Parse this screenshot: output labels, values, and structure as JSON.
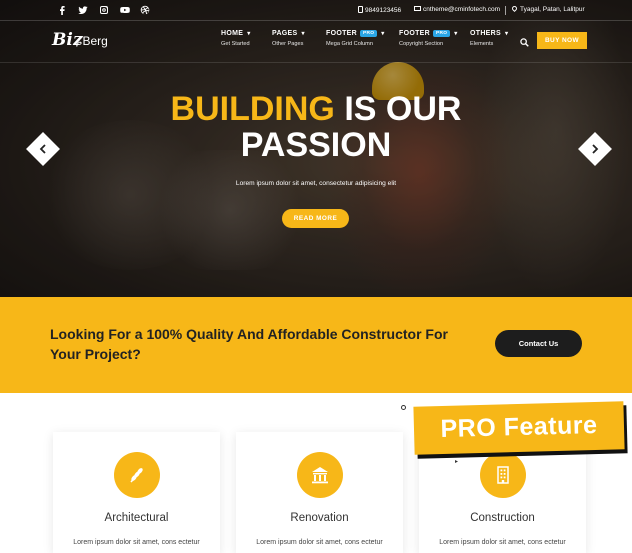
{
  "topbar": {
    "social": [
      "facebook-icon",
      "twitter-icon",
      "instagram-icon",
      "youtube-icon",
      "dribbble-icon"
    ],
    "phone": "9849123456",
    "email": "cntheme@cminfotech.com",
    "address": "Tyagal, Patan, Lalitpur"
  },
  "logo": {
    "part1": "Biʑ",
    "part2": "Berg"
  },
  "nav": {
    "items": [
      {
        "label": "HOME",
        "sub": "Get Started"
      },
      {
        "label": "PAGES",
        "sub": "Other Pages"
      },
      {
        "label": "FOOTER",
        "badge": "PRO",
        "sub": "Mega Grid Column"
      },
      {
        "label": "FOOTER",
        "badge": "PRO",
        "sub": "Copyright Section"
      },
      {
        "label": "OTHERS",
        "sub": "Elements"
      }
    ],
    "buy_label": "BUY NOW"
  },
  "hero": {
    "highlight": "BUILDING",
    "title_rest": " IS OUR",
    "title_line2": "PASSION",
    "subtitle": "Lorem ipsum dolor sit amet, consectetur adipisicing elit",
    "button": "READ MORE"
  },
  "cta": {
    "text": "Looking For a 100% Quality And Affordable Constructor For Your Project?",
    "button": "Contact Us"
  },
  "services": [
    {
      "title": "Architectural",
      "desc": "Lorem ipsum dolor sit amet, cons ectetur",
      "icon": "wheat-icon"
    },
    {
      "title": "Renovation",
      "desc": "Lorem ipsum dolor sit amet, cons ectetur",
      "icon": "building-columns-icon"
    },
    {
      "title": "Construction",
      "desc": "Lorem ipsum dolor sit amet, cons ectetur",
      "icon": "office-building-icon"
    }
  ],
  "pro_feature": "PRO Feature",
  "colors": {
    "accent": "#f7b718",
    "dark": "#1d1d1d",
    "badge": "#2aa6e6"
  }
}
